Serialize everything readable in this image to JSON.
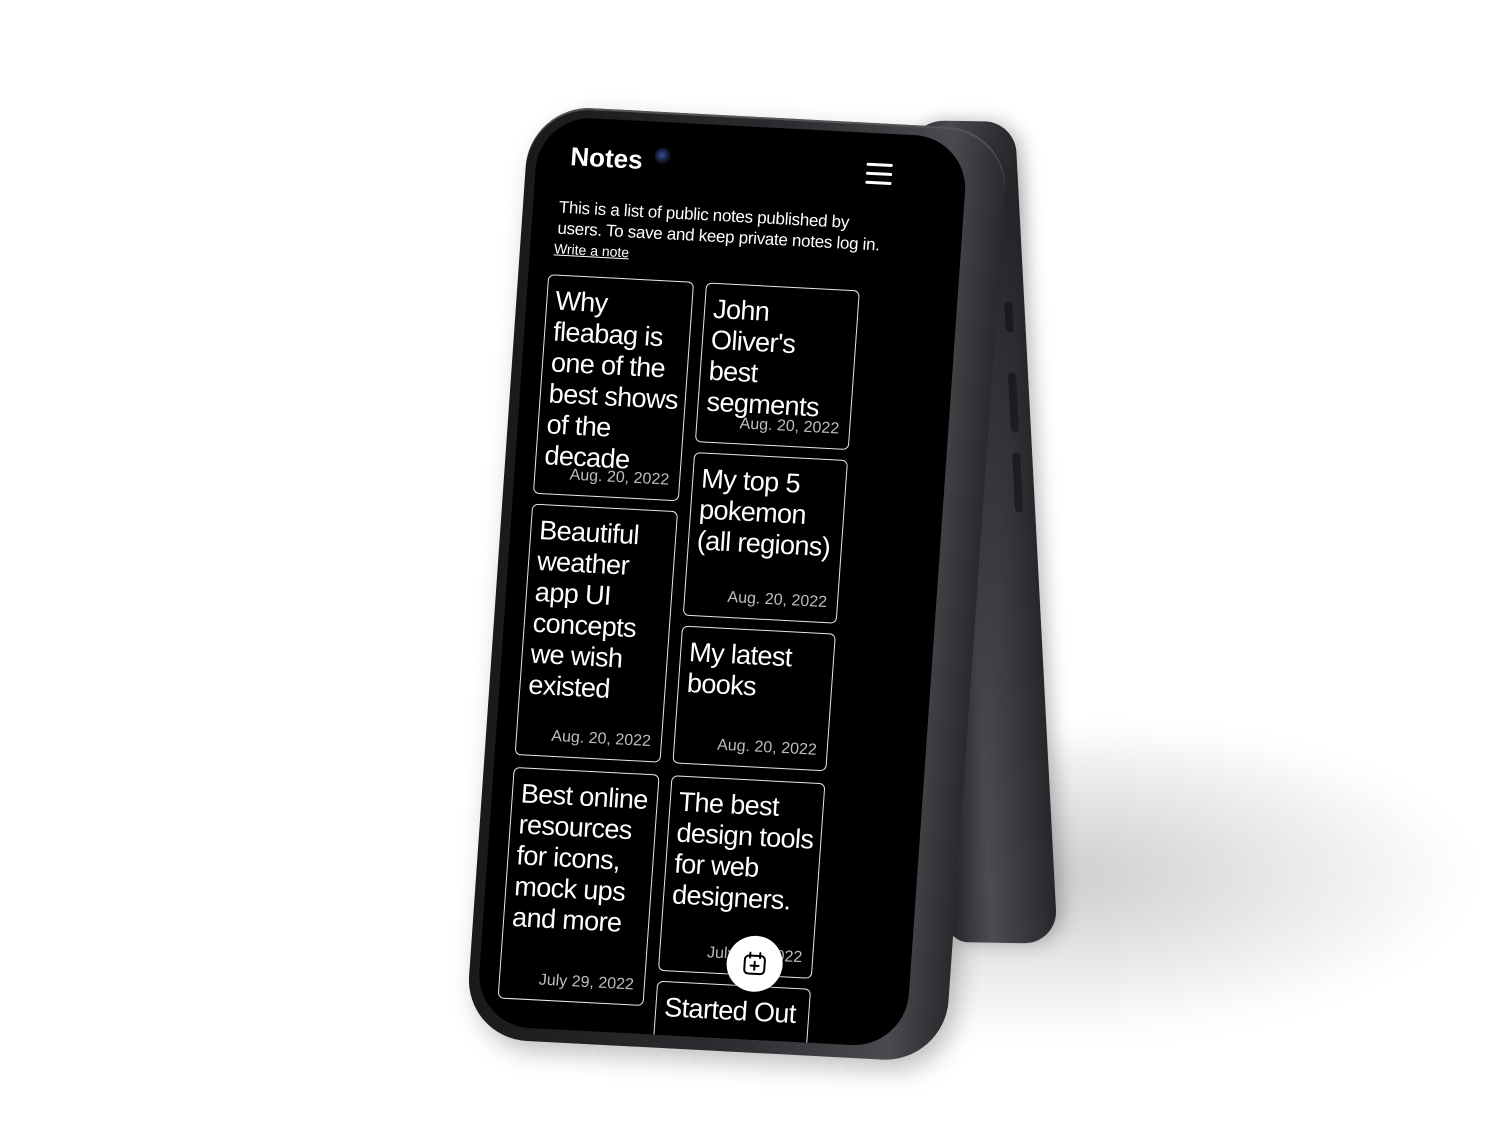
{
  "app": {
    "title": "Notes",
    "intro": "This is a list of public notes published by users. To save and keep private notes log in.",
    "write_link": "Write a note"
  },
  "notes": [
    {
      "title": "Why fleabag is one of the best shows of the decade",
      "date": "Aug. 20, 2022"
    },
    {
      "title": "John Oliver's best segments",
      "date": "Aug. 20, 2022"
    },
    {
      "title": "My top 5 pokemon (all regions)",
      "date": "Aug. 20, 2022"
    },
    {
      "title": "Beautiful weather app UI concepts we wish existed",
      "date": "Aug. 20, 2022"
    },
    {
      "title": "My latest books",
      "date": "Aug. 20, 2022"
    },
    {
      "title": "Best online resources for icons, mock ups and more",
      "date": "July 29, 2022"
    },
    {
      "title": "The best design tools for web designers.",
      "date": "July 29, 2022"
    },
    {
      "title": "Started Out",
      "date": ""
    }
  ],
  "icons": {
    "menu": "hamburger-menu-icon",
    "fab": "calendar-add-icon"
  },
  "colors": {
    "screen_background": "#000000",
    "text": "#ffffff",
    "card_border": "#e8e8e8",
    "date_text": "#bdbdbd",
    "fab_background": "#ffffff"
  }
}
